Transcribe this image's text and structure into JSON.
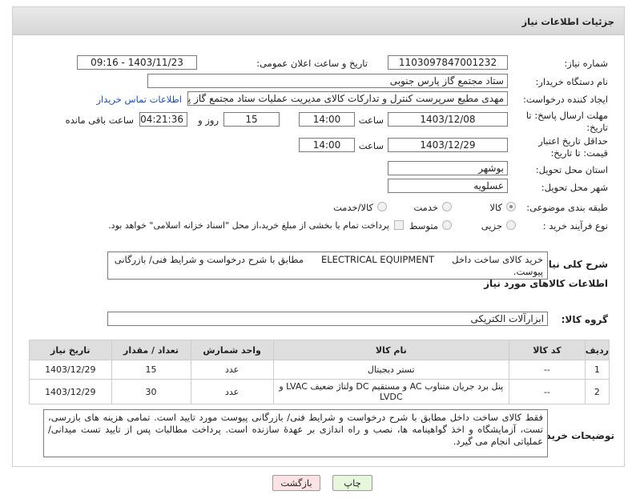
{
  "header": {
    "title": "جزئیات اطلاعات نیاز"
  },
  "fields": {
    "need_number_label": "شماره نیاز:",
    "need_number": "1103097847001232",
    "announce_label": "تاریخ و ساعت اعلان عمومی:",
    "announce_value": "1403/11/23 - 09:16",
    "buyer_org_label": "نام دستگاه خریدار:",
    "buyer_org": "ستاد مجتمع گاز پارس جنوبی",
    "creator_label": "ایجاد کننده درخواست:",
    "creator": "مهدی مطیع سرپرست کنترل و تدارکات کالای مدیریت عملیات ستاد مجتمع گاز پا",
    "contact_link": "اطلاعات تماس خریدار",
    "deadline_label": "مهلت ارسال پاسخ: تا تاریخ:",
    "deadline_date": "1403/12/08",
    "time_label": "ساعت",
    "deadline_time": "14:00",
    "days_value": "15",
    "days_label": "روز و",
    "remaining_time": "04:21:36",
    "remaining_label": "ساعت باقی مانده",
    "price_validity_label": "حداقل تاریخ اعتبار قیمت: تا تاریخ:",
    "price_validity_date": "1403/12/29",
    "price_validity_time": "14:00",
    "province_label": "استان محل تحویل:",
    "province": "بوشهر",
    "city_label": "شهر محل تحویل:",
    "city": "عسلویه",
    "category_label": "طبقه بندی موضوعی:",
    "category_options": [
      "کالا",
      "خدمت",
      "کالا/خدمت"
    ],
    "process_label": "نوع فرآیند خرید :",
    "process_options": [
      "جزیی",
      "متوسط"
    ],
    "payment_note": "پرداخت تمام یا بخشی از مبلغ خرید،از محل \"اسناد خزانه اسلامی\" خواهد بود."
  },
  "summary": {
    "label": "شرح کلی نیاز:",
    "text_a": "خرید کالای ساخت داخل",
    "text_b": "ELECTRICAL EQUIPMENT",
    "text_c": "مطابق با شرح درخواست و شرایط فنی/ بازرگانی پیوست."
  },
  "goods_section": {
    "title": "اطلاعات کالاهای مورد نیاز",
    "group_label": "گروه کالا:",
    "group_value": "ابزارآلات الکتریکی"
  },
  "table": {
    "headers": [
      "ردیف",
      "کد کالا",
      "نام کالا",
      "واحد شمارش",
      "تعداد / مقدار",
      "تاریخ نیاز"
    ],
    "rows": [
      [
        "1",
        "--",
        "تستر دیجیتال",
        "عدد",
        "15",
        "1403/12/29"
      ],
      [
        "2",
        "--",
        "پنل برد جریان متناوب AC و مستقیم DC ولتاژ ضعیف LVAC و LVDC",
        "عدد",
        "30",
        "1403/12/29"
      ]
    ]
  },
  "buyer_notes": {
    "label": "توضیحات خریدار:",
    "text": "فقط کالای ساخت داخل مطابق با شرح درخواست و شرایط فنی/ بازرگانی پیوست مورد تایید است. تمامی هزینه های بازرسی، تست، آزمایشگاه و اخذ گواهینامه ها، نصب و راه اندازی بر عهدهٔ سازنده است. پرداخت مطالبات پس از تایید تست میدانی/ عملیاتی انجام می گیرد."
  },
  "buttons": {
    "print": "چاپ",
    "back": "بازگشت"
  },
  "colors": {
    "link": "#1a4fc4",
    "back_button": "#fde3e3",
    "print_button": "#e6f7dc"
  }
}
